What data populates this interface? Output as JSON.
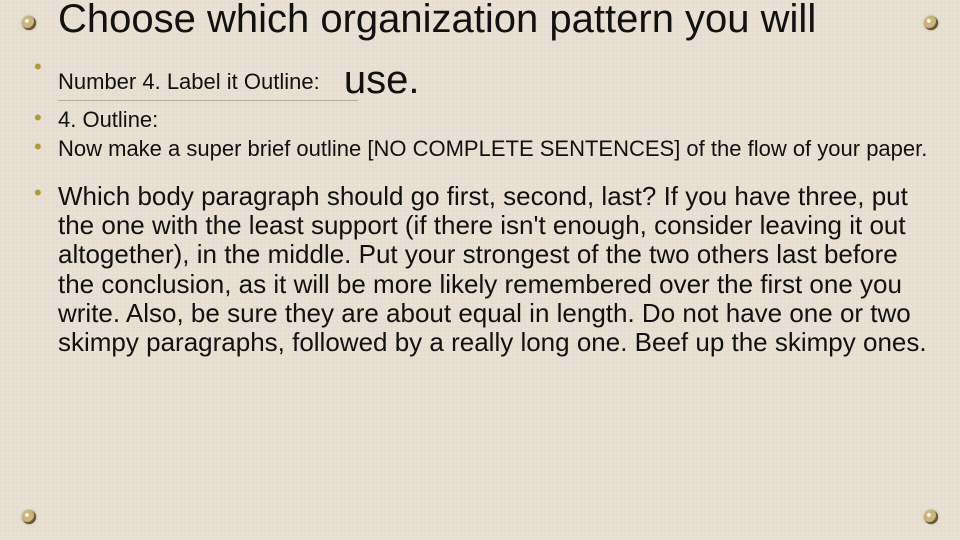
{
  "title_part1": "Choose which organization pattern you will",
  "title_part2": "use.",
  "bullets_small": [
    "Number 4. Label it Outline:",
    "4. Outline:",
    "Now make a super brief outline [NO COMPLETE SENTENCES] of the flow of your paper."
  ],
  "bullet_big": "Which body paragraph should go first, second, last? If you have three, put the one with the least support (if there isn't enough, consider leaving it out altogether), in the middle. Put your strongest of the two others last before the conclusion, as it will be more likely remembered over the first one you write.  Also, be sure they are about equal in length.  Do not have one or two skimpy paragraphs, followed by a really long one.  Beef up the skimpy ones."
}
